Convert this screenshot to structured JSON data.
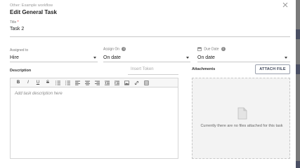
{
  "dialog": {
    "subtitle": "Other: Example workflow",
    "title": "Edit General Task"
  },
  "title_field": {
    "label": "Title",
    "required_mark": "*",
    "value": "Task 2"
  },
  "assigned_to": {
    "label": "Assigned to",
    "value": "Hire"
  },
  "assign_on": {
    "label": "Assign On",
    "value": "On date",
    "info_glyph": "i"
  },
  "due_date": {
    "label": "Due Date",
    "value": "On date",
    "info_glyph": "i"
  },
  "description": {
    "label": "Description",
    "insert_token": "Insert Token",
    "placeholder": "Add task description here",
    "toolbar": [
      "bold",
      "italic",
      "underline",
      "strikethrough",
      "ordered-list",
      "bullet-list",
      "align-left",
      "align-center",
      "align-right",
      "outdent",
      "indent",
      "image",
      "link",
      "video"
    ],
    "toolbar_glyphs": {
      "bold": "B",
      "italic": "I",
      "underline": "U",
      "strikethrough": "S"
    }
  },
  "attachments": {
    "label": "Attachments",
    "attach_button": "ATTACH FILE",
    "empty_text": "Currently there are no files attached for this task"
  },
  "colors": {
    "button_border": "#9aa0ad",
    "button_text": "#3a4256",
    "backdrop": "#6f6f6f"
  }
}
